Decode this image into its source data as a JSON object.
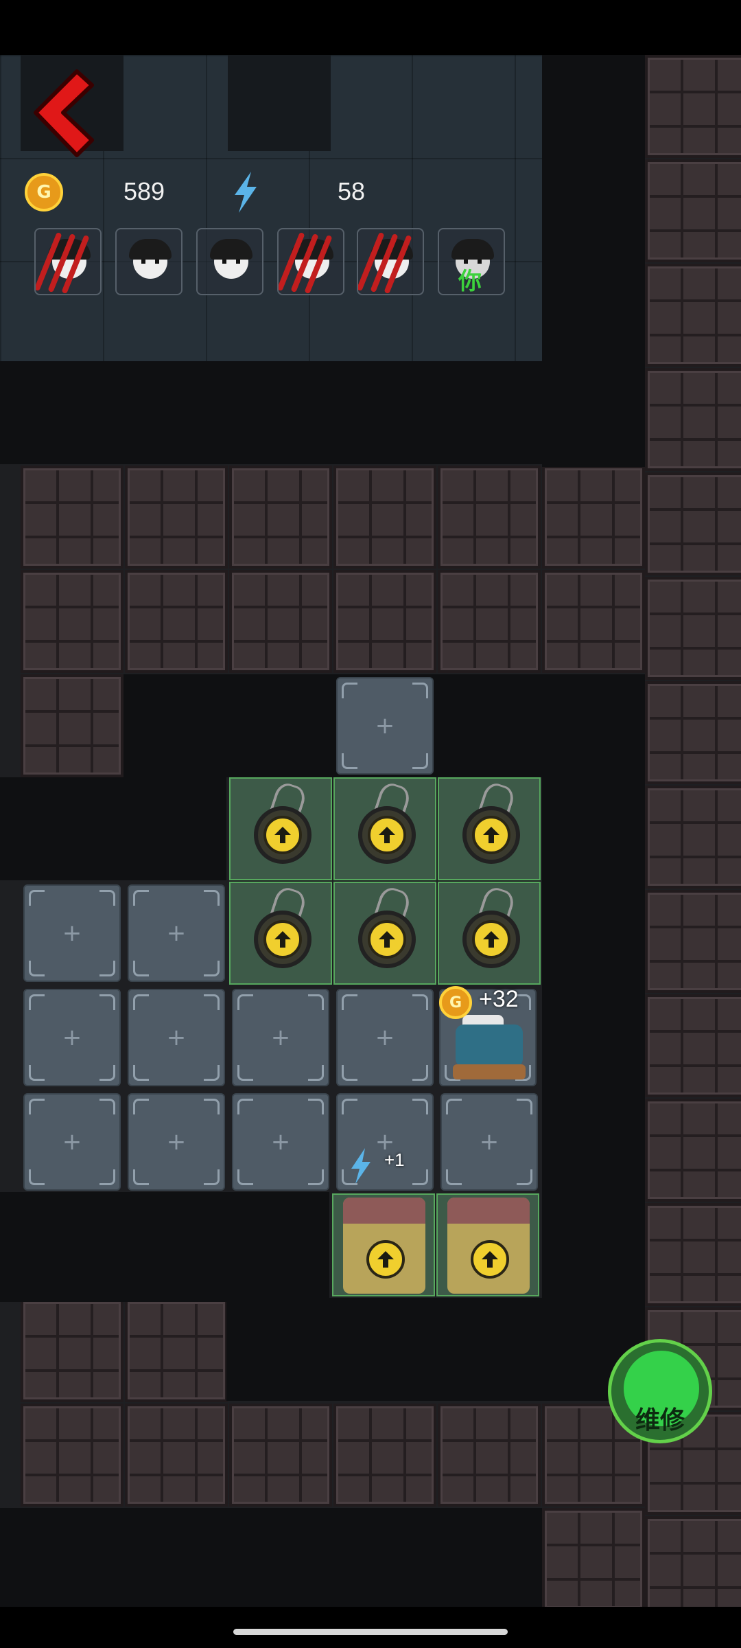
{
  "hud": {
    "gold_value": "589",
    "energy_value": "58",
    "coin_symbol": "G",
    "coin_icon": "gold-coin-icon",
    "energy_icon": "lightning-icon"
  },
  "players": [
    {
      "name": "player-slot-1",
      "state": "attacked"
    },
    {
      "name": "player-slot-2",
      "state": "normal"
    },
    {
      "name": "player-slot-3",
      "state": "normal"
    },
    {
      "name": "player-slot-4",
      "state": "attacked"
    },
    {
      "name": "player-slot-5",
      "state": "attacked"
    },
    {
      "name": "player-slot-you",
      "state": "self",
      "label": "你"
    }
  ],
  "board": {
    "bed_income": "+32",
    "energy_income": "+1",
    "repair_label": "维修",
    "plus_symbol": "+"
  },
  "colors": {
    "accent_gold": "#f0cf2e",
    "upgrade_cell": "#3d5a48",
    "empty_cell": "#4f5b66",
    "repair_green": "#34d14a",
    "back_red": "#e01818"
  }
}
